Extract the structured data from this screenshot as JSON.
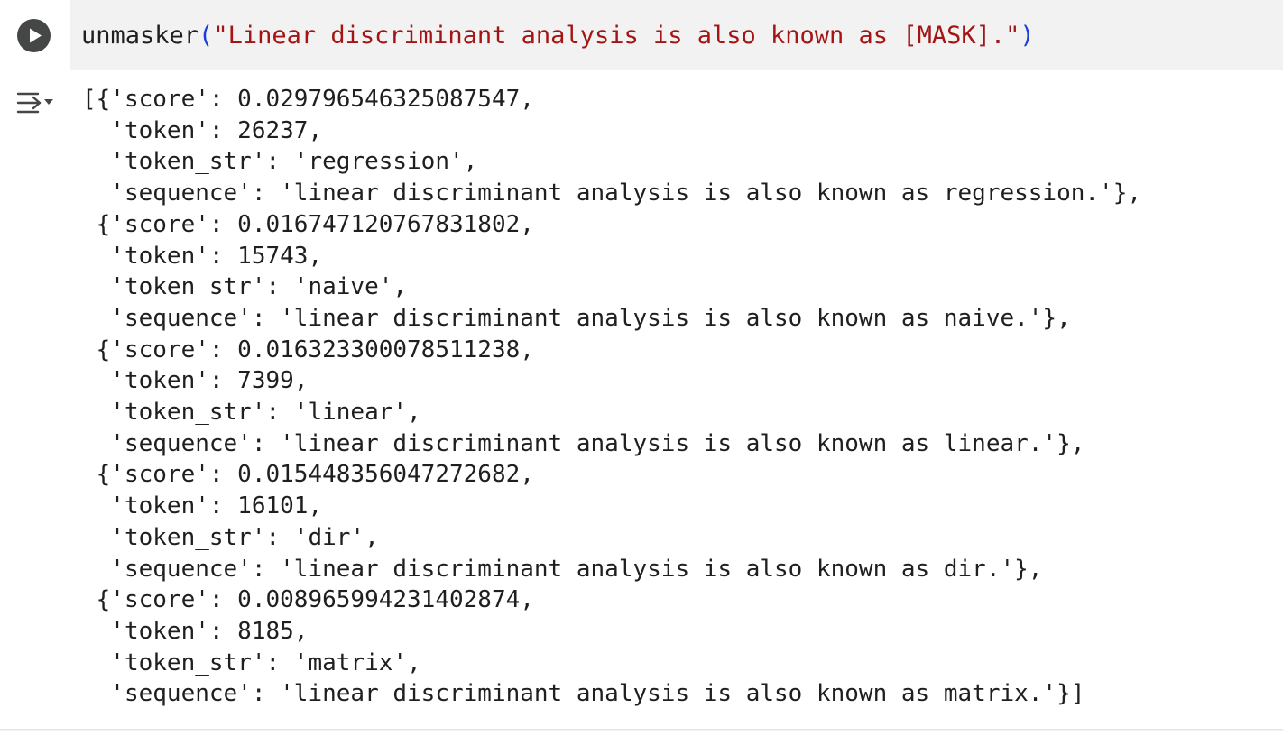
{
  "code": {
    "function_name": "unmasker",
    "open_paren": "(",
    "string_literal": "\"Linear discriminant analysis is also known as [MASK].\"",
    "close_paren": ")"
  },
  "run_button_icon": "play-circle-icon",
  "output_toggle_icon": "output-collapse-icon",
  "output": {
    "lines": [
      "[{'score': 0.029796546325087547,",
      "  'token': 26237,",
      "  'token_str': 'regression',",
      "  'sequence': 'linear discriminant analysis is also known as regression.'},",
      " {'score': 0.016747120767831802,",
      "  'token': 15743,",
      "  'token_str': 'naive',",
      "  'sequence': 'linear discriminant analysis is also known as naive.'},",
      " {'score': 0.016323300078511238,",
      "  'token': 7399,",
      "  'token_str': 'linear',",
      "  'sequence': 'linear discriminant analysis is also known as linear.'},",
      " {'score': 0.015448356047272682,",
      "  'token': 16101,",
      "  'token_str': 'dir',",
      "  'sequence': 'linear discriminant analysis is also known as dir.'},",
      " {'score': 0.008965994231402874,",
      "  'token': 8185,",
      "  'token_str': 'matrix',",
      "  'sequence': 'linear discriminant analysis is also known as matrix.'}]"
    ]
  },
  "colors": {
    "string": "#a31515",
    "paren": "#1a3fd6",
    "editor_background": "#f2f2f2",
    "run_button": "#444746"
  }
}
